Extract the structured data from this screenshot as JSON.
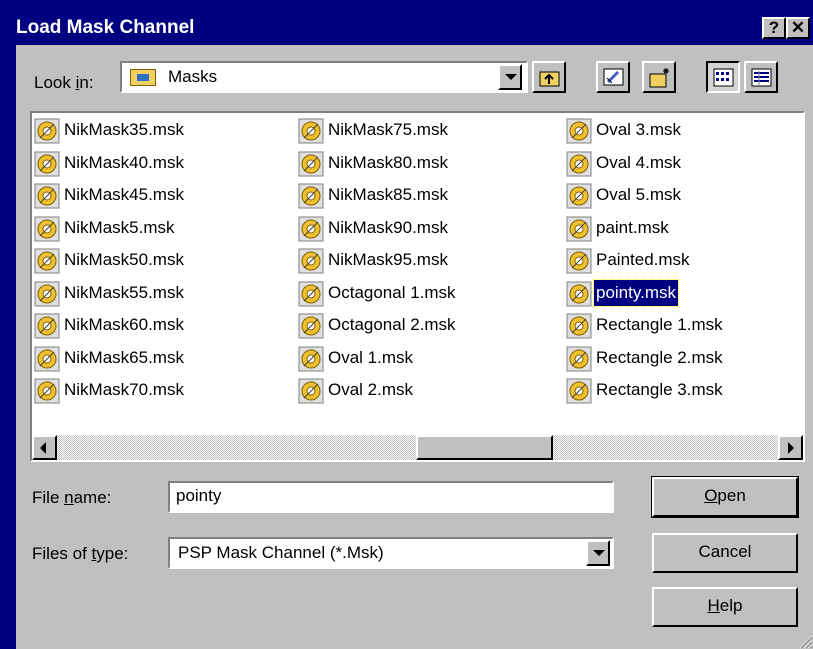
{
  "window": {
    "title": "Load Mask Channel",
    "help_button": "?",
    "close_button": "✕"
  },
  "lookin": {
    "label_prefix": "Look ",
    "label_access": "i",
    "label_suffix": "n:",
    "value": "Masks"
  },
  "toolbar": {
    "buttons": [
      "up-one-level",
      "desktop",
      "create-new-folder",
      "list-view",
      "details-view"
    ]
  },
  "files": {
    "columns": [
      [
        "NikMask35.msk",
        "NikMask40.msk",
        "NikMask45.msk",
        "NikMask5.msk",
        "NikMask50.msk",
        "NikMask55.msk",
        "NikMask60.msk",
        "NikMask65.msk",
        "NikMask70.msk"
      ],
      [
        "NikMask75.msk",
        "NikMask80.msk",
        "NikMask85.msk",
        "NikMask90.msk",
        "NikMask95.msk",
        "Octagonal 1.msk",
        "Octagonal 2.msk",
        "Oval 1.msk",
        "Oval 2.msk"
      ],
      [
        "Oval 3.msk",
        "Oval 4.msk",
        "Oval 5.msk",
        "paint.msk",
        "Painted.msk",
        "pointy.msk",
        "Rectangle 1.msk",
        "Rectangle 2.msk",
        "Rectangle 3.msk"
      ]
    ],
    "selected": "pointy.msk"
  },
  "filename": {
    "label_prefix": "File ",
    "label_access": "n",
    "label_suffix": "ame:",
    "value": "pointy"
  },
  "filetype": {
    "label_prefix": "Files of ",
    "label_access": "t",
    "label_suffix": "ype:",
    "value": "PSP Mask Channel (*.Msk)"
  },
  "buttons": {
    "open_access": "O",
    "open_rest": "pen",
    "cancel": "Cancel",
    "help_access": "H",
    "help_rest": "elp"
  },
  "colors": {
    "titlebar": "#000080",
    "face": "#c0c0c0",
    "selection": "#000080"
  }
}
